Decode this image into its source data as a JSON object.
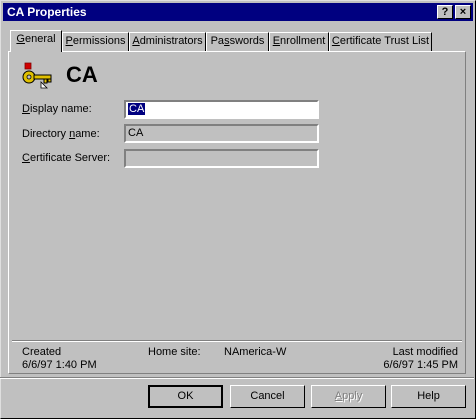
{
  "window": {
    "title": "CA Properties"
  },
  "titlebar": {
    "help_glyph": "?",
    "close_glyph": "×"
  },
  "tabs": [
    {
      "pre": "",
      "u": "G",
      "post": "eneral"
    },
    {
      "pre": "",
      "u": "P",
      "post": "ermissions"
    },
    {
      "pre": "",
      "u": "A",
      "post": "dministrators"
    },
    {
      "pre": "Pa",
      "u": "s",
      "post": "swords"
    },
    {
      "pre": "",
      "u": "E",
      "post": "nrollment"
    },
    {
      "pre": "",
      "u": "C",
      "post": "ertificate Trust List"
    }
  ],
  "header": {
    "name": "CA",
    "icon": "key-certificate-icon"
  },
  "fields": {
    "display_name": {
      "pre": "",
      "u": "D",
      "post": "isplay name:",
      "value": "CA"
    },
    "directory_name": {
      "pre": "Directory ",
      "u": "n",
      "post": "ame:",
      "value": "CA"
    },
    "certificate_server": {
      "pre": "",
      "u": "C",
      "post": "ertificate Server:",
      "value": ""
    }
  },
  "info": {
    "created_label": "Created",
    "created_value": "6/6/97  1:40 PM",
    "home_site_label": "Home site:",
    "home_site_value": "NAmerica-W",
    "last_modified_label": "Last modified",
    "last_modified_value": "6/6/97  1:45 PM"
  },
  "buttons": {
    "ok": "OK",
    "cancel": "Cancel",
    "apply_u": "A",
    "apply_post": "pply",
    "help": "Help"
  }
}
